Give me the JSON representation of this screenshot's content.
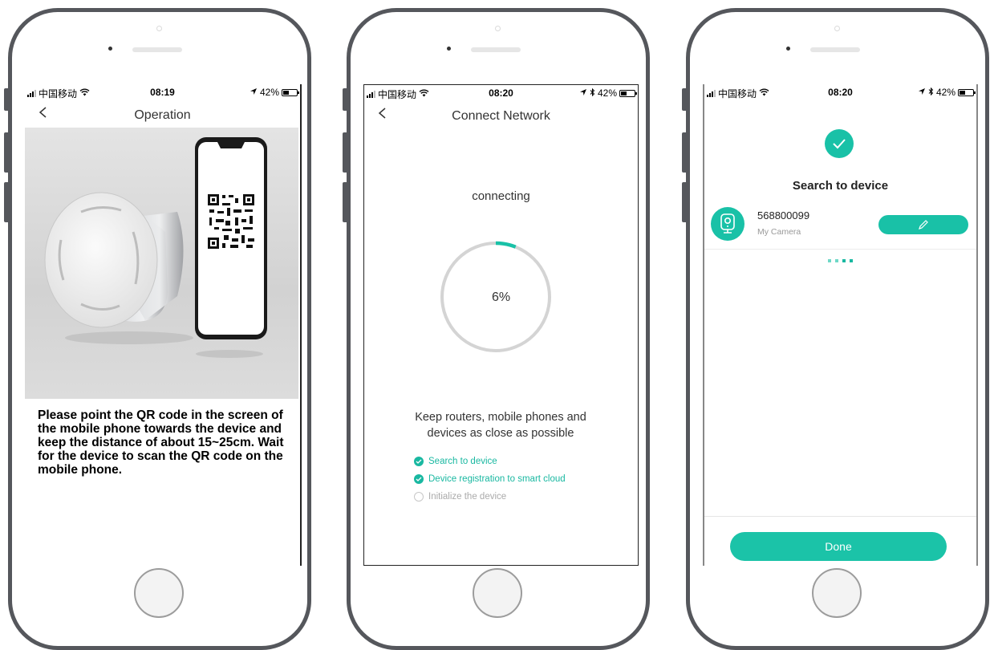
{
  "colors": {
    "accent": "#19c1a7",
    "frame": "#55575c",
    "progress_track": "#d4d4d4"
  },
  "phone1": {
    "status": {
      "carrier": "中国移动",
      "time": "08:19",
      "battery": "42%",
      "battery_level": 0.42
    },
    "nav": {
      "title": "Operation",
      "back_icon": "chevron-left-icon"
    },
    "instructions": "Please point the QR code in the screen of the mobile phone towards the device and keep the distance of about 15~25cm. Wait for the device to scan the QR code on the mobile phone."
  },
  "phone2": {
    "status": {
      "carrier": "中国移动",
      "time": "08:20",
      "battery": "42%",
      "battery_level": 0.42
    },
    "nav": {
      "title": "Connect Network",
      "back_icon": "chevron-left-icon"
    },
    "connecting_label": "connecting",
    "progress": {
      "value": 0.06,
      "label": "6%"
    },
    "tip": "Keep routers, mobile phones and devices as close as possible",
    "steps": [
      {
        "label": "Search to device",
        "done": true
      },
      {
        "label": "Device registration to smart cloud",
        "done": true
      },
      {
        "label": "Initialize the device",
        "done": false
      }
    ]
  },
  "phone3": {
    "status": {
      "carrier": "中国移动",
      "time": "08:20",
      "battery": "42%",
      "battery_level": 0.42
    },
    "success_icon": "check-circle-icon",
    "title": "Search to device",
    "device": {
      "id": "568800099",
      "name": "My Camera",
      "icon": "camera-icon",
      "edit_icon": "pencil-icon"
    },
    "done_label": "Done"
  }
}
